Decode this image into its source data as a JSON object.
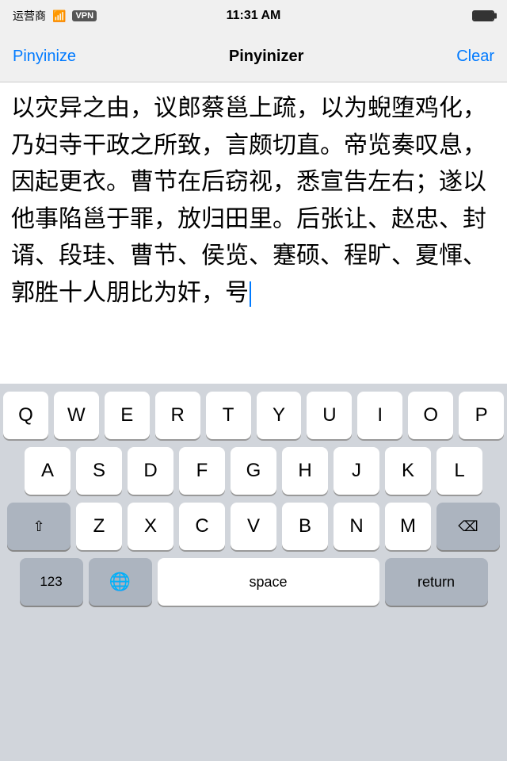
{
  "status_bar": {
    "carrier": "运营商",
    "wifi": "WiFi",
    "vpn": "VPN",
    "time": "11:31 AM"
  },
  "nav": {
    "left_label": "Pinyinize",
    "title": "Pinyinizer",
    "right_label": "Clear"
  },
  "content": {
    "text_before_cursor": "以灾异之由，议郎蔡邕上疏，以为蜺堕鸡化，乃妇寺干政之所致，言颇切直。帝览奏叹息，因起更衣。曹节在后窃视，悉宣告左右；遂以他事陷邕于罪，放归田里。后张让、赵忠、封谞、段珪、曹节、侯览、蹇硕、程旷、夏惲、郭胜十人朋比为奸，号",
    "text_after_cursor": ""
  },
  "keyboard": {
    "row1": [
      "Q",
      "W",
      "E",
      "R",
      "T",
      "Y",
      "U",
      "I",
      "O",
      "P"
    ],
    "row2": [
      "A",
      "S",
      "D",
      "F",
      "G",
      "H",
      "J",
      "K",
      "L"
    ],
    "row3": [
      "Z",
      "X",
      "C",
      "V",
      "B",
      "N",
      "M"
    ],
    "bottom": {
      "numbers": "123",
      "globe": "🌐",
      "space": "space",
      "return": "return",
      "delete": "⌫",
      "shift": "⇧"
    }
  }
}
